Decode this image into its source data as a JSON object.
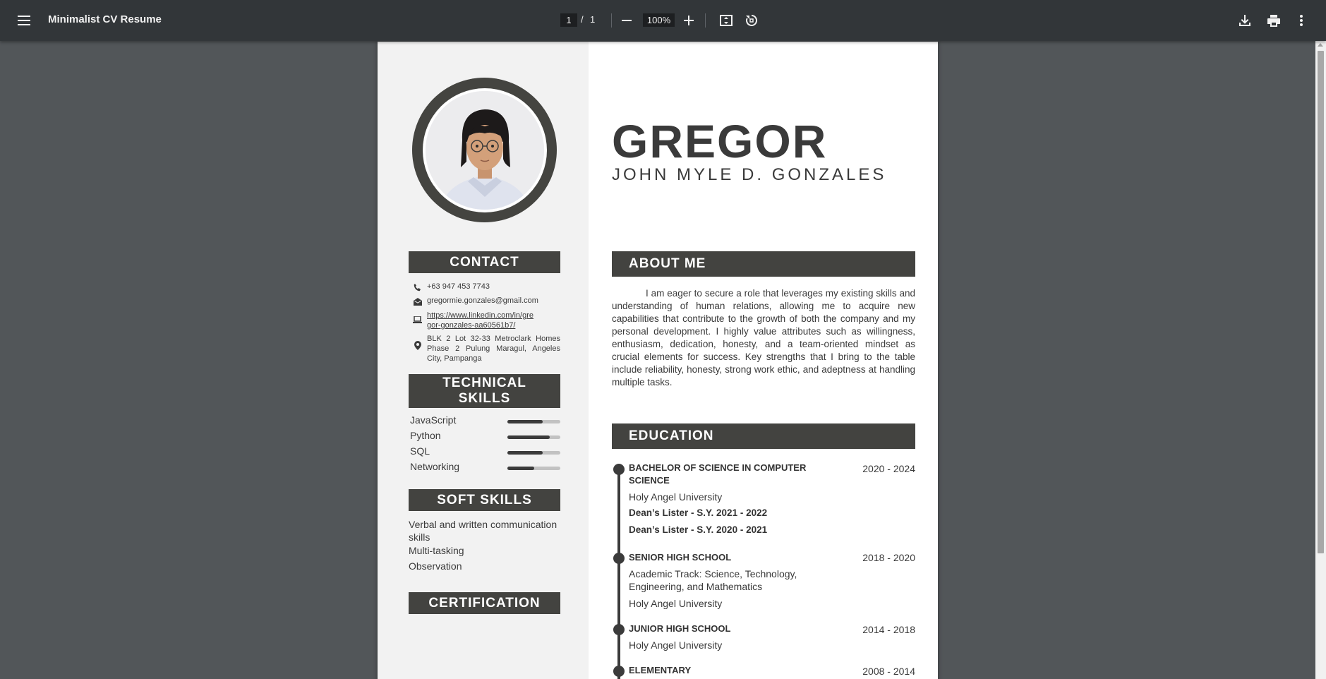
{
  "toolbar": {
    "title": "Minimalist CV Resume",
    "current_page": "1",
    "page_separator": "/",
    "total_pages": "1",
    "zoom": "100%",
    "icons": [
      "menu-icon",
      "zoom-out-icon",
      "zoom-in-icon",
      "fit-page-icon",
      "rotate-icon",
      "download-icon",
      "print-icon",
      "more-icon"
    ]
  },
  "resume": {
    "first_name": "GREGOR",
    "full_name": "JOHN MYLE D. GONZALES",
    "contact": {
      "heading": "CONTACT",
      "phone": "+63 947 453 7743",
      "email": "gregormie.gonzales@gmail.com",
      "linkedin": "https://www.linkedin.com/in/gregor-gonzales-aa60561b7/",
      "linkedin_line1": "https://www.linkedin.com/in/gre",
      "linkedin_line2": "gor-gonzales-aa60561b7/",
      "address": "BLK 2 Lot 32-33 Metroclark Homes Phase 2 Pulung Maragul, Angeles City, Pampanga"
    },
    "technical_skills": {
      "heading_line1": "TECHNICAL",
      "heading_line2": "SKILLS",
      "items": [
        {
          "name": "JavaScript",
          "level": 0.67
        },
        {
          "name": "Python",
          "level": 0.8
        },
        {
          "name": "SQL",
          "level": 0.67
        },
        {
          "name": "Networking",
          "level": 0.5
        }
      ]
    },
    "soft_skills": {
      "heading": "SOFT SKILLS",
      "items": [
        "Verbal and written communication skills",
        "Multi-tasking",
        "Observation"
      ]
    },
    "certification": {
      "heading": "CERTIFICATION"
    },
    "about": {
      "heading": "ABOUT ME",
      "text": "I am eager to secure a role that leverages my existing skills and understanding of human relations, allowing me to acquire new capabilities that contribute to the growth of both the company and my personal development. I highly value attributes such as willingness, enthusiasm, dedication, honesty, and a team-oriented mindset as crucial elements for success. Key strengths that I bring to the table include reliability, honesty, strong work ethic, and adeptness at handling multiple tasks."
    },
    "education": {
      "heading": "EDUCATION",
      "entries": [
        {
          "title": "BACHELOR OF SCIENCE IN COMPUTER SCIENCE",
          "years": "2020 - 2024",
          "school": "Holy Angel University",
          "honors": [
            "Dean’s Lister - S.Y. 2021 - 2022",
            "Dean’s Lister - S.Y. 2020 - 2021"
          ]
        },
        {
          "title": "SENIOR HIGH SCHOOL",
          "years": "2018 - 2020",
          "track": "Academic Track: Science, Technology, Engineering, and Mathematics",
          "school": "Holy Angel University"
        },
        {
          "title": "JUNIOR HIGH SCHOOL",
          "years": "2014 - 2018",
          "school": "Holy Angel University"
        },
        {
          "title": "ELEMENTARY",
          "years": "2008 - 2014"
        }
      ]
    }
  }
}
